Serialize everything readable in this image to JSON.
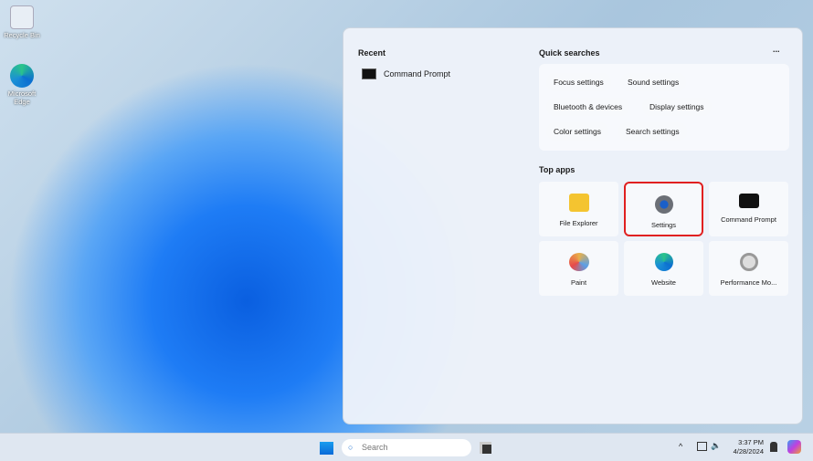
{
  "desktop": {
    "icons": [
      {
        "label": "Recycle Bin",
        "icon": "recycle-bin-icon"
      },
      {
        "label": "Microsoft Edge",
        "icon": "edge-icon"
      }
    ]
  },
  "start_panel": {
    "recent_title": "Recent",
    "recent": [
      {
        "label": "Command Prompt",
        "icon": "command-prompt-icon"
      }
    ],
    "quick_title": "Quick searches",
    "more": "...",
    "quick": [
      "Focus settings",
      "Sound settings",
      "Bluetooth & devices",
      "Display settings",
      "Color settings",
      "Search settings"
    ],
    "top_apps_title": "Top apps",
    "apps": [
      {
        "label": "File Explorer",
        "icon": "folder-icon",
        "color": "#f4c430"
      },
      {
        "label": "Settings",
        "icon": "gear-icon",
        "color": "#6b6f76",
        "selected": true
      },
      {
        "label": "Command Prompt",
        "icon": "command-prompt-icon",
        "color": "#111111"
      },
      {
        "label": "Paint",
        "icon": "paint-palette-icon",
        "color": "#e8b04a"
      },
      {
        "label": "Website",
        "icon": "edge-icon",
        "color": "#1a8fd6"
      },
      {
        "label": "Performance Mo...",
        "icon": "performance-monitor-icon",
        "color": "#a0a0a0"
      }
    ]
  },
  "taskbar": {
    "search_placeholder": "Search",
    "time": "3:37 PM",
    "date": "4/28/2024",
    "chevron": "^"
  }
}
